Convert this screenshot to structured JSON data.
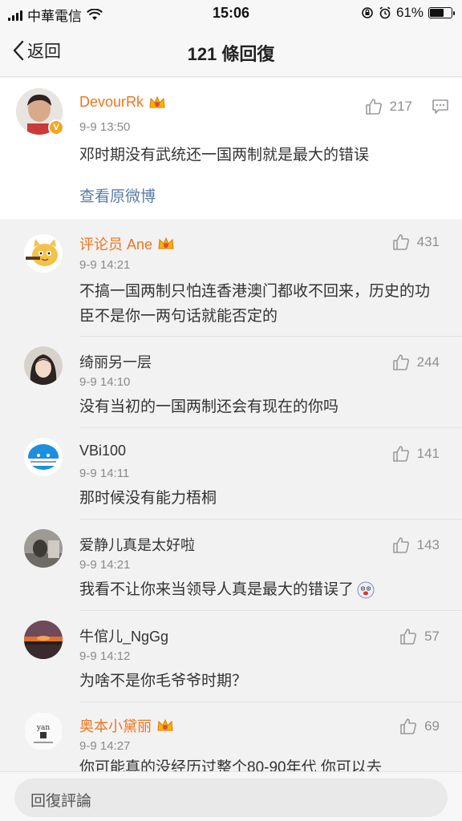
{
  "status_bar": {
    "carrier": "中華電信",
    "time": "15:06",
    "battery": "61%",
    "battery_level": 0.61
  },
  "nav": {
    "back_label": "返回",
    "title": "121 條回復"
  },
  "post": {
    "username": "DevourRk",
    "time": "9-9 13:50",
    "likes": "217",
    "text": "邓时期没有武统还一国两制就是最大的错误",
    "view_original": "查看原微博"
  },
  "comments": [
    {
      "username": "评论员 Ane",
      "vip": true,
      "time": "9-9 14:21",
      "likes": "431",
      "text": "不搞一国两制只怕连香港澳门都收不回来，历史的功臣不是你一两句话就能否定的"
    },
    {
      "username": "绮丽另一层",
      "vip": false,
      "time": "9-9 14:10",
      "likes": "244",
      "text": "没有当初的一国两制还会有现在的你吗"
    },
    {
      "username": "VBi100",
      "vip": false,
      "time": "9-9 14:11",
      "likes": "141",
      "text": "那时候没有能力梧桐"
    },
    {
      "username": "爱静儿真是太好啦",
      "vip": false,
      "time": "9-9 14:21",
      "likes": "143",
      "text": "我看不让你来当领导人真是最大的错误了"
    },
    {
      "username": "牛倌儿_NgGg",
      "vip": false,
      "time": "9-9 14:12",
      "likes": "57",
      "text": "为啥不是你毛爷爷时期？"
    },
    {
      "username": "奥本小黛丽",
      "vip": true,
      "time": "9-9 14:27",
      "likes": "69",
      "text": "你可能真的没经历过整个80-90年代 你可以去"
    }
  ],
  "reply_bar": {
    "placeholder": "回復評論"
  },
  "colors": {
    "vip_name": "#f0751f",
    "link": "#5b7ca3",
    "muted": "#8a8a8a"
  }
}
